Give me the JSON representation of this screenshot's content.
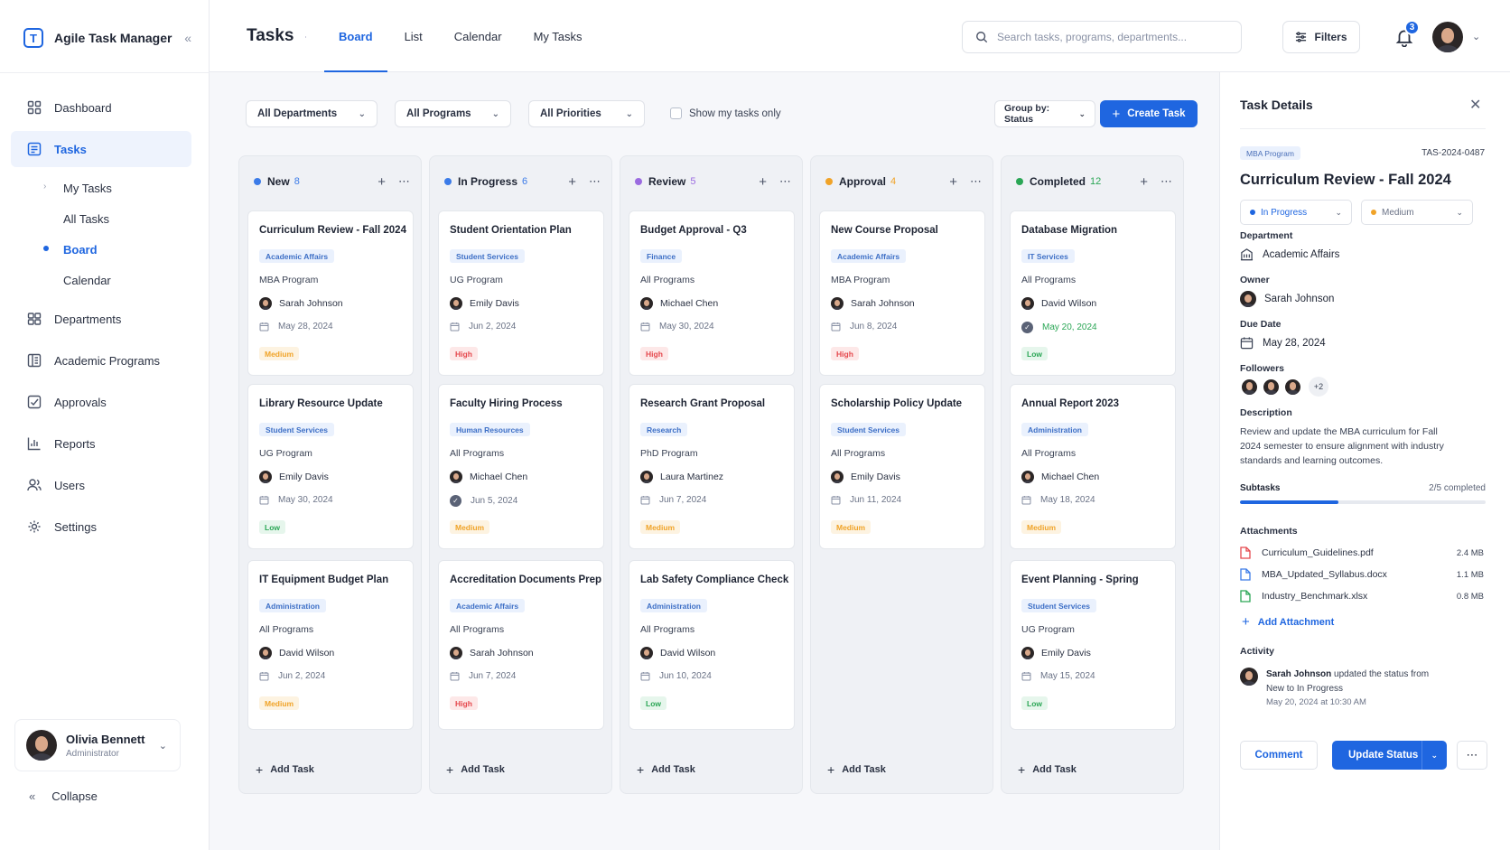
{
  "app": {
    "name": "Agile Task Manager",
    "logo_letter": "T"
  },
  "sidebar": {
    "nav": [
      {
        "label": "Dashboard",
        "icon": "dashboard-icon"
      },
      {
        "label": "Tasks",
        "icon": "tasks-icon",
        "active": true
      },
      {
        "label": "Departments",
        "icon": "departments-icon"
      },
      {
        "label": "Academic Programs",
        "icon": "programs-icon"
      },
      {
        "label": "Approvals",
        "icon": "approvals-icon"
      },
      {
        "label": "Reports",
        "icon": "reports-icon"
      },
      {
        "label": "Users",
        "icon": "users-icon"
      },
      {
        "label": "Settings",
        "icon": "settings-icon"
      }
    ],
    "sub_nav": [
      "My Tasks",
      "All Tasks",
      "Board",
      "Calendar"
    ],
    "user": {
      "name": "Olivia Bennett",
      "role": "Administrator"
    },
    "collapse_label": "Collapse"
  },
  "header": {
    "title": "Tasks",
    "tabs": [
      "Board",
      "List",
      "Calendar",
      "My Tasks"
    ],
    "search_placeholder": "Search tasks, programs, departments...",
    "filters_label": "Filters",
    "notification_count": "3"
  },
  "filters": {
    "department": "All Departments",
    "program": "All Programs",
    "priority": "All Priorities",
    "my_tasks_only": "Show my tasks only",
    "group_by": "Group by: Status",
    "create_task": "Create Task"
  },
  "board": {
    "add_task_label": "Add Task",
    "columns": [
      {
        "name": "New",
        "count": "8",
        "color": "#3b7be8",
        "cards": [
          {
            "title": "Curriculum Review - Fall 2024",
            "tag": "Academic Affairs",
            "program": "MBA Program",
            "owner": "Sarah Johnson",
            "date": "May 28, 2024",
            "priority": "Medium"
          },
          {
            "title": "Library Resource Update",
            "tag": "Student Services",
            "program": "UG Program",
            "owner": "Emily Davis",
            "date": "May 30, 2024",
            "priority": "Low"
          },
          {
            "title": "IT Equipment Budget Plan",
            "tag": "Administration",
            "program": "All Programs",
            "owner": "David Wilson",
            "date": "Jun 2, 2024",
            "priority": "Medium"
          }
        ]
      },
      {
        "name": "In Progress",
        "count": "6",
        "color": "#3b7be8",
        "cards": [
          {
            "title": "Student Orientation Plan",
            "tag": "Student Services",
            "program": "UG Program",
            "owner": "Emily Davis",
            "date": "Jun 2, 2024",
            "priority": "High"
          },
          {
            "title": "Faculty Hiring Process",
            "tag": "Human Resources",
            "program": "All Programs",
            "owner": "Michael Chen",
            "date": "Jun 5, 2024",
            "priority": "Medium",
            "done": true
          },
          {
            "title": "Accreditation Documents Prep",
            "tag": "Academic Affairs",
            "program": "All Programs",
            "owner": "Sarah Johnson",
            "date": "Jun 7, 2024",
            "priority": "High"
          }
        ]
      },
      {
        "name": "Review",
        "count": "5",
        "color": "#9b6be0",
        "cards": [
          {
            "title": "Budget Approval - Q3",
            "tag": "Finance",
            "program": "All Programs",
            "owner": "Michael Chen",
            "date": "May 30, 2024",
            "priority": "High"
          },
          {
            "title": "Research Grant Proposal",
            "tag": "Research",
            "program": "PhD Program",
            "owner": "Laura Martinez",
            "date": "Jun 7, 2024",
            "priority": "Medium"
          },
          {
            "title": "Lab Safety Compliance Check",
            "tag": "Administration",
            "program": "All Programs",
            "owner": "David Wilson",
            "date": "Jun 10, 2024",
            "priority": "Low"
          }
        ]
      },
      {
        "name": "Approval",
        "count": "4",
        "color": "#f0a328",
        "cards": [
          {
            "title": "New Course Proposal",
            "tag": "Academic Affairs",
            "program": "MBA Program",
            "owner": "Sarah Johnson",
            "date": "Jun 8, 2024",
            "priority": "High"
          },
          {
            "title": "Scholarship Policy Update",
            "tag": "Student Services",
            "program": "All Programs",
            "owner": "Emily Davis",
            "date": "Jun 11, 2024",
            "priority": "Medium"
          }
        ]
      },
      {
        "name": "Completed",
        "count": "12",
        "color": "#2aa655",
        "cards": [
          {
            "title": "Database Migration",
            "tag": "IT Services",
            "program": "All Programs",
            "owner": "David Wilson",
            "date": "May 20, 2024",
            "priority": "Low",
            "done": true,
            "date_color": "#2aa655"
          },
          {
            "title": "Annual Report 2023",
            "tag": "Administration",
            "program": "All Programs",
            "owner": "Michael Chen",
            "date": "May 18, 2024",
            "priority": "Medium"
          },
          {
            "title": "Event Planning - Spring",
            "tag": "Student Services",
            "program": "UG Program",
            "owner": "Emily Davis",
            "date": "May 15, 2024",
            "priority": "Low"
          }
        ]
      }
    ]
  },
  "details": {
    "panel_title": "Task Details",
    "program_tag": "MBA Program",
    "task_id": "TAS-2024-0487",
    "title": "Curriculum Review - Fall 2024",
    "status": "In Progress",
    "priority": "Medium",
    "department_label": "Department",
    "department": "Academic Affairs",
    "owner_label": "Owner",
    "owner": "Sarah Johnson",
    "due_label": "Due Date",
    "due": "May 28, 2024",
    "followers_label": "Followers",
    "followers_more": "+2",
    "description_label": "Description",
    "description": "Review and update the MBA curriculum for Fall 2024 semester to ensure alignment with industry standards and learning outcomes.",
    "subtasks_label": "Subtasks",
    "subtasks_progress": "2/5 completed",
    "subtasks_fraction": 0.4,
    "attachments_label": "Attachments",
    "attachments": [
      {
        "name": "Curriculum_Guidelines.pdf",
        "size": "2.4 MB",
        "color": "#e5484d"
      },
      {
        "name": "MBA_Updated_Syllabus.docx",
        "size": "1.1 MB",
        "color": "#3b7be8"
      },
      {
        "name": "Industry_Benchmark.xlsx",
        "size": "0.8 MB",
        "color": "#2aa655"
      }
    ],
    "add_attachment": "Add Attachment",
    "activity_label": "Activity",
    "activity": {
      "user": "Sarah Johnson",
      "text": "updated the status from New to In Progress",
      "time": "May 20, 2024 at 10:30 AM"
    },
    "comment_label": "Comment",
    "update_label": "Update Status"
  },
  "colors": {
    "accent": "#1f66e0",
    "priority_medium": "#f0a328",
    "priority_high": "#e5484d",
    "priority_low": "#2aa655"
  }
}
